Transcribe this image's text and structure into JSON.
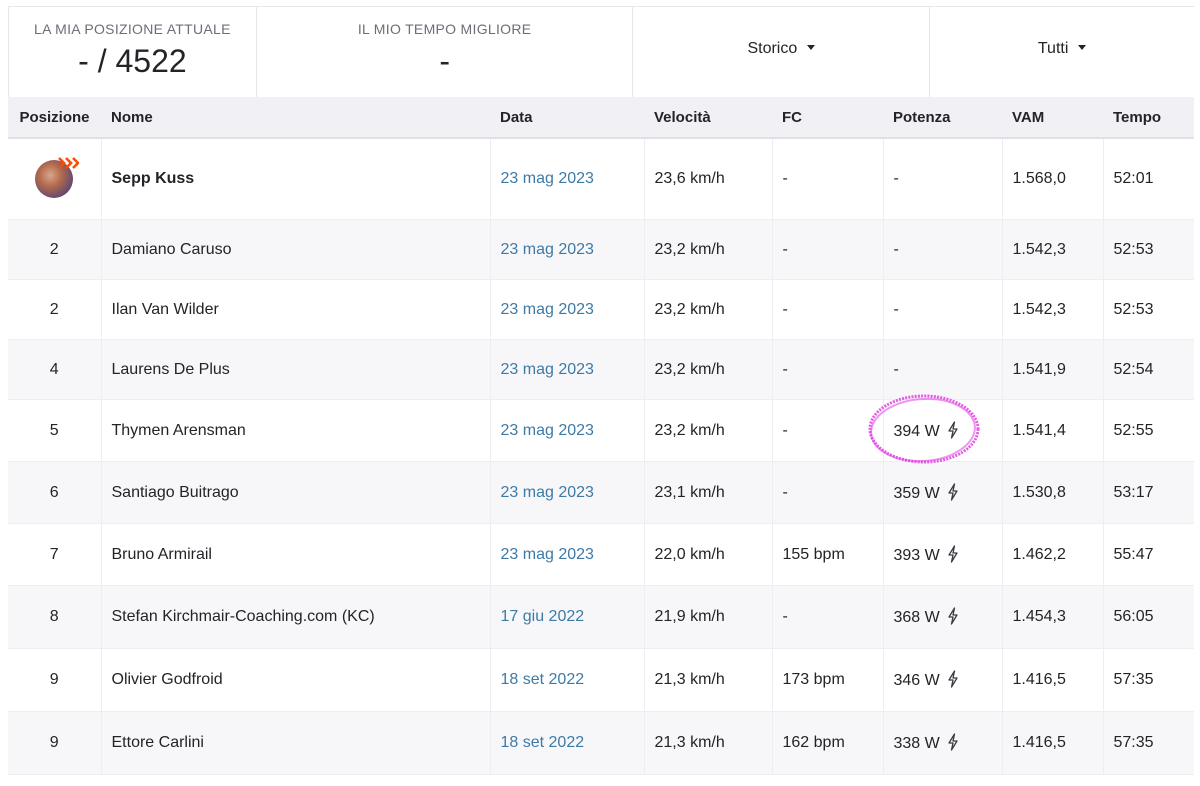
{
  "header": {
    "rank_label": "LA MIA POSIZIONE ATTUALE",
    "rank_value": "- / 4522",
    "best_label": "IL MIO TEMPO MIGLIORE",
    "best_value": "-",
    "filter_history": "Storico",
    "filter_all": "Tutti"
  },
  "table": {
    "columns": {
      "pos": "Posizione",
      "name": "Nome",
      "date": "Data",
      "speed": "Velocità",
      "hr": "FC",
      "power": "Potenza",
      "vam": "VAM",
      "time": "Tempo"
    },
    "rows": [
      {
        "pos": "",
        "name": "Sepp Kuss",
        "date": "23 mag 2023",
        "speed": "23,6 km/h",
        "hr": "-",
        "power": "-",
        "vam": "1.568,0",
        "time": "52:01"
      },
      {
        "pos": "2",
        "name": "Damiano Caruso",
        "date": "23 mag 2023",
        "speed": "23,2 km/h",
        "hr": "-",
        "power": "-",
        "vam": "1.542,3",
        "time": "52:53"
      },
      {
        "pos": "2",
        "name": "Ilan Van Wilder",
        "date": "23 mag 2023",
        "speed": "23,2 km/h",
        "hr": "-",
        "power": "-",
        "vam": "1.542,3",
        "time": "52:53"
      },
      {
        "pos": "4",
        "name": "Laurens De Plus",
        "date": "23 mag 2023",
        "speed": "23,2 km/h",
        "hr": "-",
        "power": "-",
        "vam": "1.541,9",
        "time": "52:54"
      },
      {
        "pos": "5",
        "name": "Thymen Arensman",
        "date": "23 mag 2023",
        "speed": "23,2 km/h",
        "hr": "-",
        "power": "394 W",
        "vam": "1.541,4",
        "time": "52:55"
      },
      {
        "pos": "6",
        "name": "Santiago Buitrago",
        "date": "23 mag 2023",
        "speed": "23,1 km/h",
        "hr": "-",
        "power": "359 W",
        "vam": "1.530,8",
        "time": "53:17"
      },
      {
        "pos": "7",
        "name": "Bruno Armirail",
        "date": "23 mag 2023",
        "speed": "22,0 km/h",
        "hr": "155 bpm",
        "power": "393 W",
        "vam": "1.462,2",
        "time": "55:47"
      },
      {
        "pos": "8",
        "name": "Stefan Kirchmair-Coaching.com (KC)",
        "date": "17 giu 2022",
        "speed": "21,9 km/h",
        "hr": "-",
        "power": "368 W",
        "vam": "1.454,3",
        "time": "56:05"
      },
      {
        "pos": "9",
        "name": "Olivier Godfroid",
        "date": "18 set 2022",
        "speed": "21,3 km/h",
        "hr": "173 bpm",
        "power": "346 W",
        "vam": "1.416,5",
        "time": "57:35"
      },
      {
        "pos": "9",
        "name": "Ettore Carlini",
        "date": "18 set 2022",
        "speed": "21,3 km/h",
        "hr": "162 bpm",
        "power": "338 W",
        "vam": "1.416,5",
        "time": "57:35"
      }
    ]
  },
  "colors": {
    "link": "#3d7aa6",
    "header_bg": "#f0f0f5",
    "stripe_bg": "#f7f7fa",
    "highlight_mark": "#e040e0"
  },
  "icons": {
    "power": "lightning-bolt-icon",
    "leader": "crown-chevron-icon"
  }
}
